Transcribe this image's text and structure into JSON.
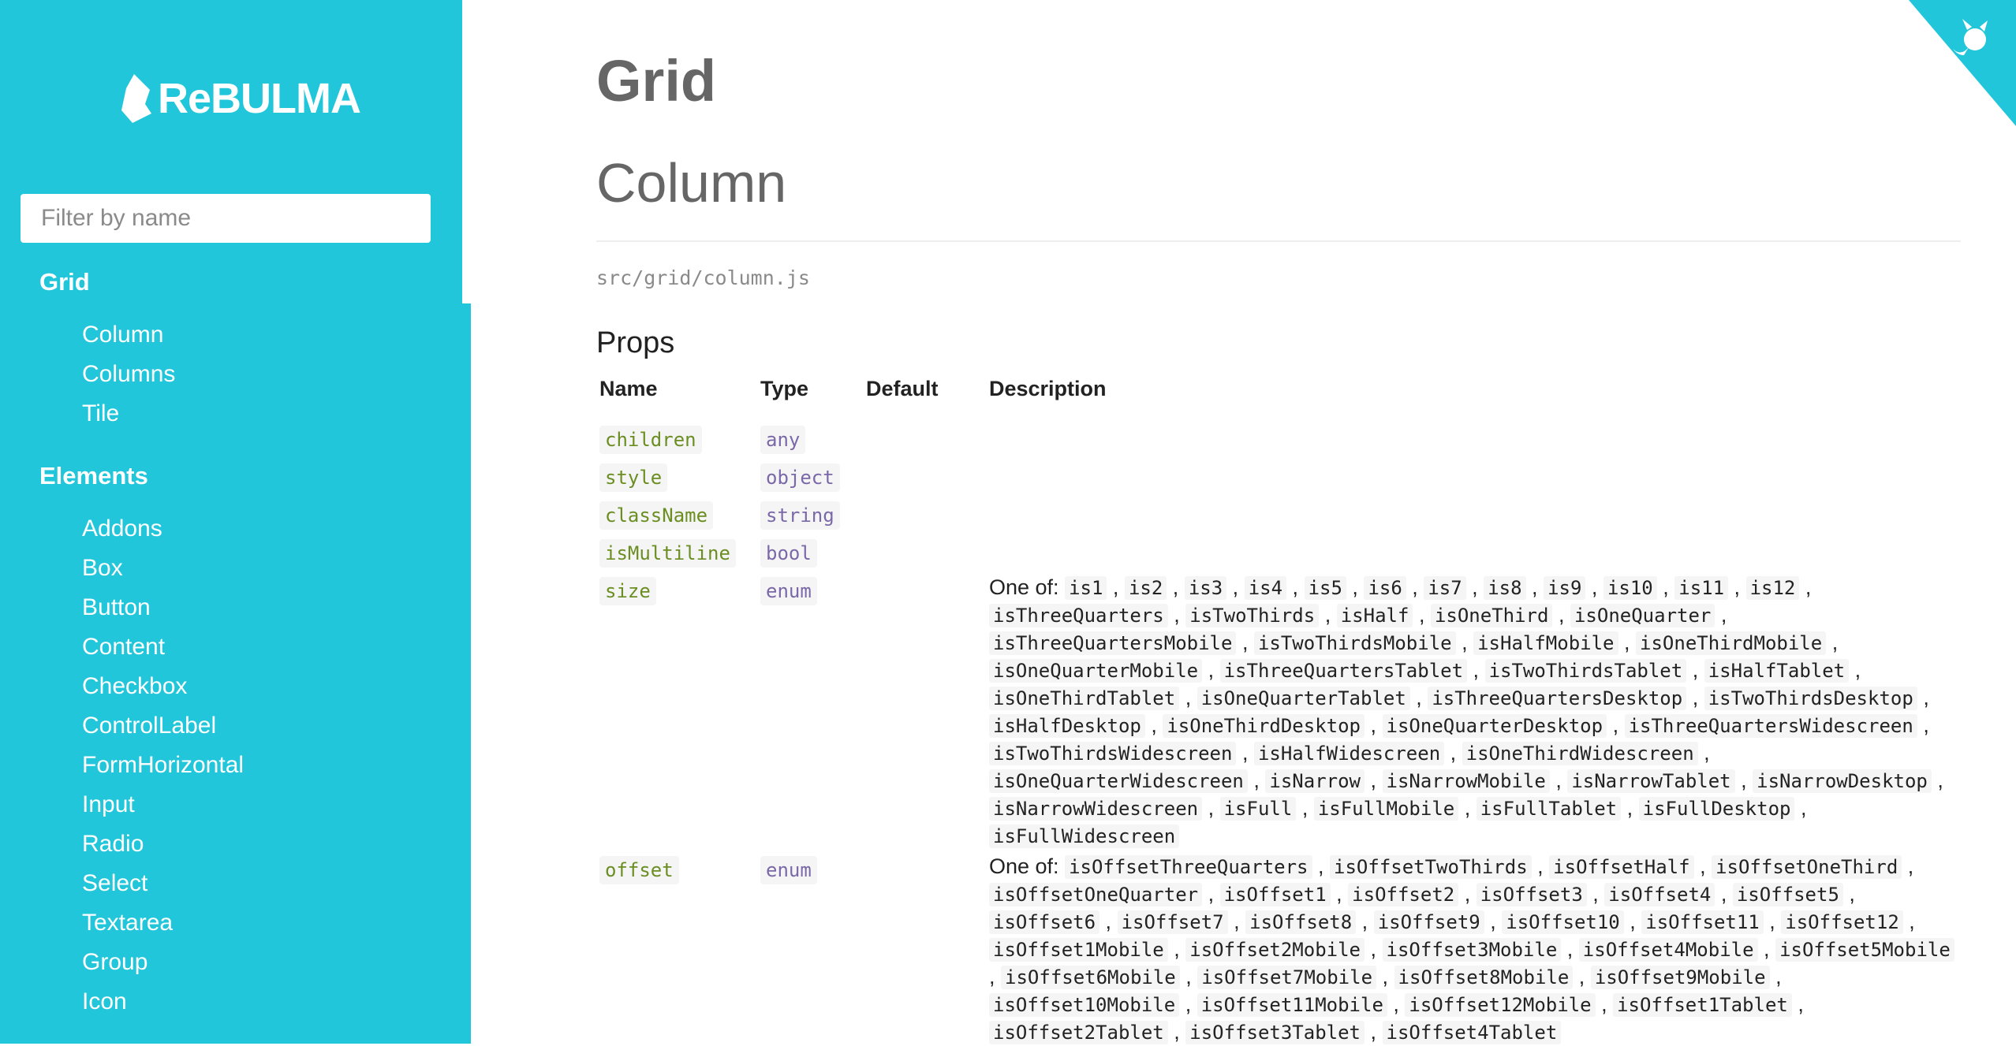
{
  "sidebar": {
    "logo_text": "ReBULMA",
    "filter_placeholder": "Filter by name",
    "sections": [
      {
        "title": "Grid",
        "items": [
          "Column",
          "Columns",
          "Tile"
        ]
      },
      {
        "title": "Elements",
        "items": [
          "Addons",
          "Box",
          "Button",
          "Content",
          "Checkbox",
          "ControlLabel",
          "FormHorizontal",
          "Input",
          "Radio",
          "Select",
          "Textarea",
          "Group",
          "Icon"
        ]
      }
    ]
  },
  "main": {
    "section_title": "Grid",
    "component_title": "Column",
    "source_path": "src/grid/column.js",
    "props_title": "Props",
    "table": {
      "headers": [
        "Name",
        "Type",
        "Default",
        "Description"
      ],
      "rows": [
        {
          "name": "children",
          "type": "any",
          "default": "",
          "one_of_label": "",
          "options": []
        },
        {
          "name": "style",
          "type": "object",
          "default": "",
          "one_of_label": "",
          "options": []
        },
        {
          "name": "className",
          "type": "string",
          "default": "",
          "one_of_label": "",
          "options": []
        },
        {
          "name": "isMultiline",
          "type": "bool",
          "default": "",
          "one_of_label": "",
          "options": []
        },
        {
          "name": "size",
          "type": "enum",
          "default": "",
          "one_of_label": "One of:",
          "options": [
            "is1",
            "is2",
            "is3",
            "is4",
            "is5",
            "is6",
            "is7",
            "is8",
            "is9",
            "is10",
            "is11",
            "is12",
            "isThreeQuarters",
            "isTwoThirds",
            "isHalf",
            "isOneThird",
            "isOneQuarter",
            "isThreeQuartersMobile",
            "isTwoThirdsMobile",
            "isHalfMobile",
            "isOneThirdMobile",
            "isOneQuarterMobile",
            "isThreeQuartersTablet",
            "isTwoThirdsTablet",
            "isHalfTablet",
            "isOneThirdTablet",
            "isOneQuarterTablet",
            "isThreeQuartersDesktop",
            "isTwoThirdsDesktop",
            "isHalfDesktop",
            "isOneThirdDesktop",
            "isOneQuarterDesktop",
            "isThreeQuartersWidescreen",
            "isTwoThirdsWidescreen",
            "isHalfWidescreen",
            "isOneThirdWidescreen",
            "isOneQuarterWidescreen",
            "isNarrow",
            "isNarrowMobile",
            "isNarrowTablet",
            "isNarrowDesktop",
            "isNarrowWidescreen",
            "isFull",
            "isFullMobile",
            "isFullTablet",
            "isFullDesktop",
            "isFullWidescreen"
          ]
        },
        {
          "name": "offset",
          "type": "enum",
          "default": "",
          "one_of_label": "One of:",
          "options": [
            "isOffsetThreeQuarters",
            "isOffsetTwoThirds",
            "isOffsetHalf",
            "isOffsetOneThird",
            "isOffsetOneQuarter",
            "isOffset1",
            "isOffset2",
            "isOffset3",
            "isOffset4",
            "isOffset5",
            "isOffset6",
            "isOffset7",
            "isOffset8",
            "isOffset9",
            "isOffset10",
            "isOffset11",
            "isOffset12",
            "isOffset1Mobile",
            "isOffset2Mobile",
            "isOffset3Mobile",
            "isOffset4Mobile",
            "isOffset5Mobile",
            "isOffset6Mobile",
            "isOffset7Mobile",
            "isOffset8Mobile",
            "isOffset9Mobile",
            "isOffset10Mobile",
            "isOffset11Mobile",
            "isOffset12Mobile",
            "isOffset1Tablet",
            "isOffset2Tablet",
            "isOffset3Tablet",
            "isOffset4Tablet"
          ]
        }
      ]
    }
  },
  "colors": {
    "sidebar": "#21c6da",
    "name_code": "#6b8e23",
    "type_code": "#7b68a8",
    "code_bg": "#f5f5f5"
  },
  "icons": {
    "logo": "bulma-logo-icon",
    "corner": "github-octocat-icon"
  }
}
